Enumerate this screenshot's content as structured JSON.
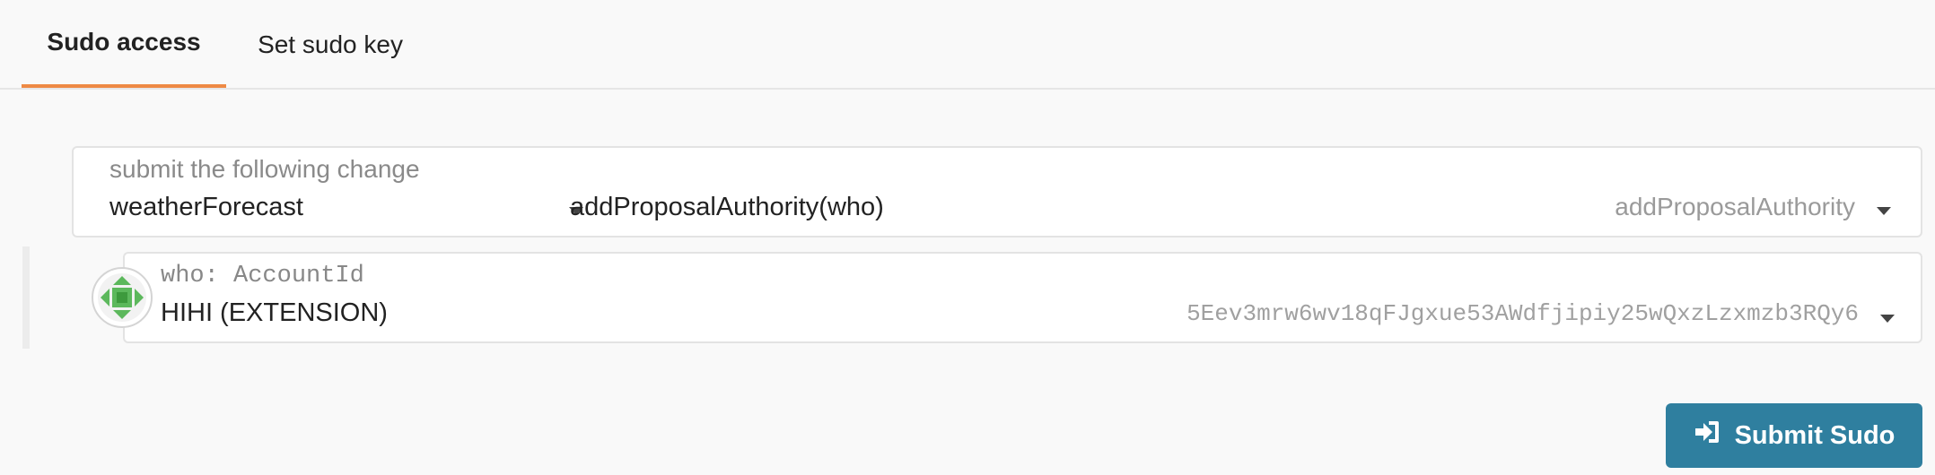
{
  "tabs": [
    {
      "label": "Sudo access",
      "active": true
    },
    {
      "label": "Set sudo key",
      "active": false
    }
  ],
  "call": {
    "label": "submit the following change",
    "section": "weatherForecast",
    "method": "addProposalAuthority(who)",
    "method_hint": "addProposalAuthority"
  },
  "param": {
    "label": "who: AccountId",
    "account_name": "HIHI (EXTENSION)",
    "account_address": "5Eev3mrw6wv18qFJgxue53AWdfjipiy25wQxzLzxmzb3RQy6"
  },
  "submit": {
    "label": "Submit Sudo",
    "icon": "sign-in-icon"
  },
  "colors": {
    "accent": "#ee8a45",
    "button": "#2f7f9f",
    "identicon": "#5cb85c"
  }
}
